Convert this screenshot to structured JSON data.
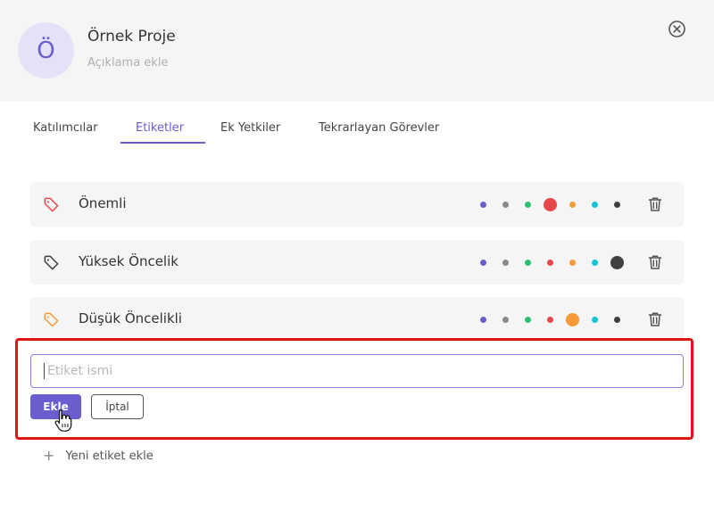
{
  "project": {
    "avatar_letter": "Ö",
    "title": "Örnek Proje",
    "description_placeholder": "Açıklama ekle"
  },
  "tabs": [
    {
      "label": "Katılımcılar",
      "active": false
    },
    {
      "label": "Etiketler",
      "active": true
    },
    {
      "label": "Ek Yetkiler",
      "active": false
    },
    {
      "label": "Tekrarlayan Görevler",
      "active": false
    }
  ],
  "palette": [
    "#6a5ecf",
    "#8a8a8a",
    "#2fbf71",
    "#e5474b",
    "#f59a38",
    "#18c3d8",
    "#3f3f3f"
  ],
  "tags": [
    {
      "label": "Önemli",
      "color": "#e5474b",
      "selected_color_index": 3
    },
    {
      "label": "Yüksek Öncelik",
      "color": "#3f3f3f",
      "selected_color_index": 6
    },
    {
      "label": "Düşük Öncelikli",
      "color": "#f59a38",
      "selected_color_index": 4
    }
  ],
  "new_tag_form": {
    "name_placeholder": "Etiket ismi",
    "name_value": "",
    "add_label": "Ekle",
    "cancel_label": "İptal"
  },
  "add_new_tag_label": "Yeni etiket ekle"
}
